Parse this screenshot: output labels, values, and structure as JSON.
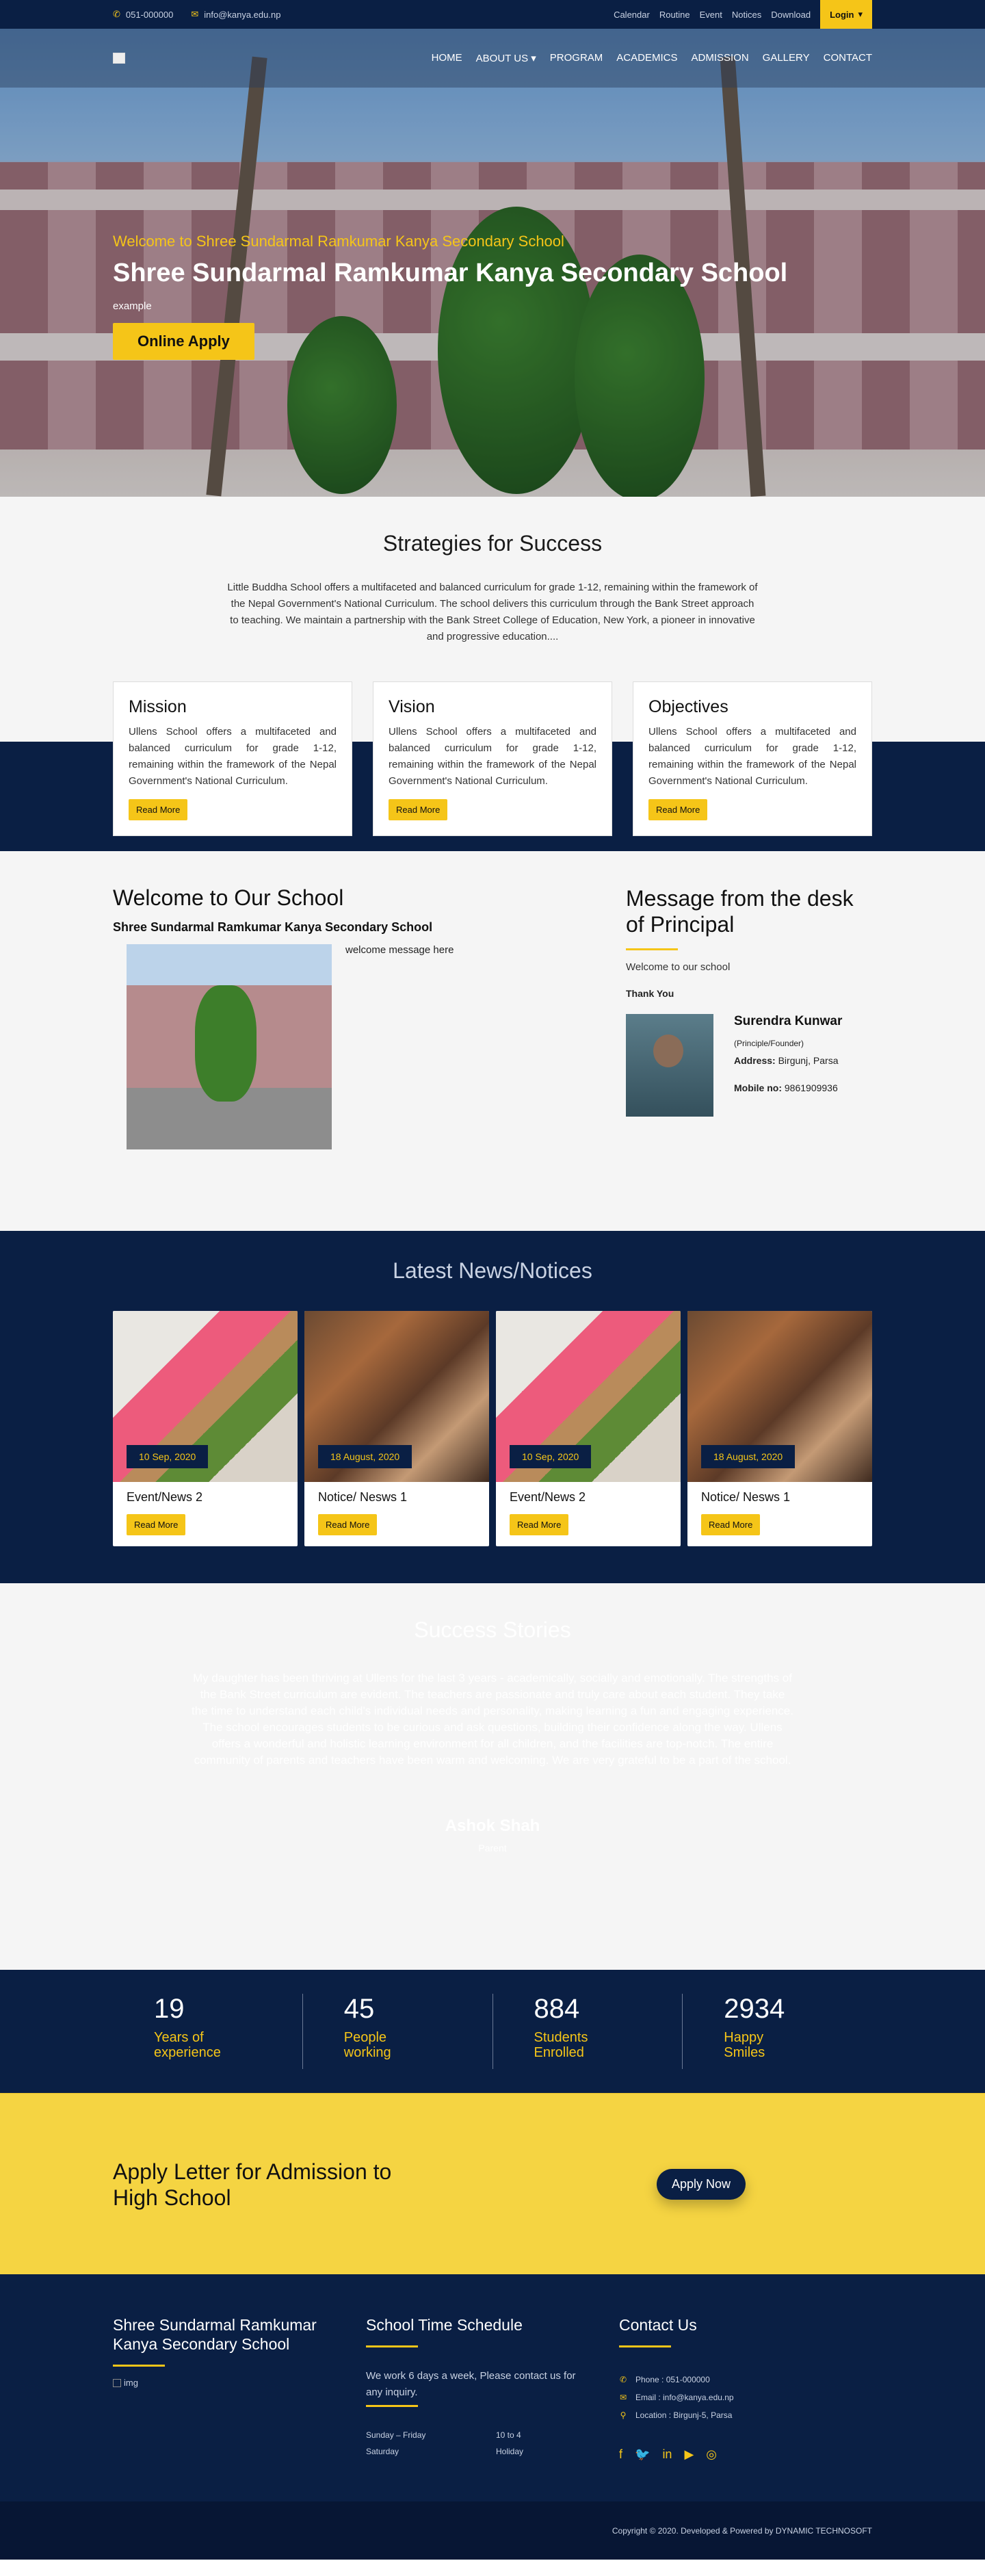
{
  "topbar": {
    "phone": "051-000000",
    "email": "info@kanya.edu.np",
    "links": [
      "Calendar",
      "Routine",
      "Event",
      "Notices",
      "Download"
    ],
    "login": "Login"
  },
  "nav": {
    "items": [
      "HOME",
      "ABOUT US",
      "PROGRAM",
      "ACADEMICS",
      "ADMISSION",
      "GALLERY",
      "CONTACT"
    ]
  },
  "hero": {
    "subtitle": "Welcome to Shree Sundarmal Ramkumar Kanya Secondary School",
    "title": "Shree Sundarmal Ramkumar Kanya Secondary School",
    "example": "example",
    "apply": "Online Apply"
  },
  "strategies": {
    "title": "Strategies for Success",
    "text": "Little Buddha School offers a multifaceted and balanced curriculum for grade 1-12, remaining within the framework of the Nepal Government's National Curriculum. The school delivers this curriculum through the Bank Street approach to teaching. We maintain a partnership with the Bank Street College of Education, New York, a pioneer in innovative and progressive education...."
  },
  "cards": [
    {
      "title": "Mission",
      "text": "Ullens School offers a multifaceted and balanced curriculum for grade 1-12, remaining within the framework of the Nepal Government's National Curriculum.",
      "btn": "Read More"
    },
    {
      "title": "Vision",
      "text": "Ullens School offers a multifaceted and balanced curriculum for grade 1-12, remaining within the framework of the Nepal Government's National Curriculum.",
      "btn": "Read More"
    },
    {
      "title": "Objectives",
      "text": "Ullens School offers a multifaceted and balanced curriculum for grade 1-12, remaining within the framework of the Nepal Government's National Curriculum.",
      "btn": "Read More"
    }
  ],
  "welcome": {
    "title": "Welcome to Our School",
    "subtitle": "Shree Sundarmal Ramkumar Kanya Secondary School",
    "message": "welcome message here"
  },
  "principal": {
    "title": "Message from the desk of Principal",
    "welcome": "Welcome to our school",
    "thanks": "Thank You",
    "name": "Surendra Kunwar",
    "position": "(Principle/Founder)",
    "address_label": "Address:",
    "address": "Birgunj, Parsa",
    "mobile_label": "Mobile no:",
    "mobile": "9861909936"
  },
  "news": {
    "title": "Latest News/Notices",
    "items": [
      {
        "date": "10 Sep, 2020",
        "title": "Event/News 2",
        "btn": "Read More"
      },
      {
        "date": "18 August, 2020",
        "title": "Notice/ Nesws 1",
        "btn": "Read More"
      },
      {
        "date": "10 Sep, 2020",
        "title": "Event/News 2",
        "btn": "Read More"
      },
      {
        "date": "18 August, 2020",
        "title": "Notice/ Nesws 1",
        "btn": "Read More"
      }
    ]
  },
  "success": {
    "title": "Success Stories",
    "text": "My daughter has been thriving at Ullens for the last 3 years - academically, socially and emotionally. The strengths of the Bank Street curriculum are evident. The teachers are passionate and truly care about each student. They take the time to understand each child's individual needs and personality, making learning a fun and engaging experience. The school encourages students to be curious and ask questions, building their confidence along the way. Ullens offers a wonderful and holistic learning environment for all children, and the facilities are top-notch. The entire community of parents and teachers have been warm and welcoming. We are very grateful to be a part of the school.",
    "name": "Ashok Shah",
    "role": "Parent"
  },
  "counters": [
    {
      "num": "19",
      "label": "Years of experience"
    },
    {
      "num": "45",
      "label": "People working"
    },
    {
      "num": "884",
      "label": "Students Enrolled"
    },
    {
      "num": "2934",
      "label": "Happy Smiles"
    }
  ],
  "apply": {
    "title": "Apply Letter for Admission to High School",
    "btn": "Apply Now"
  },
  "footer": {
    "school": "Shree Sundarmal Ramkumar Kanya Secondary School",
    "img_alt": "img",
    "schedule_title": "School Time Schedule",
    "schedule_text": "We work 6 days a week, Please contact us for any inquiry.",
    "rows": [
      [
        "Sunday – Friday",
        "10 to 4"
      ],
      [
        "Saturday",
        "Holiday"
      ]
    ],
    "contact_title": "Contact Us",
    "phone": "Phone : 051-000000",
    "email": "Email : info@kanya.edu.np",
    "location": "Location : Birgunj-5, Parsa",
    "copyright": "Copyright © 2020. Developed & Powered by DYNAMIC TECHNOSOFT"
  }
}
